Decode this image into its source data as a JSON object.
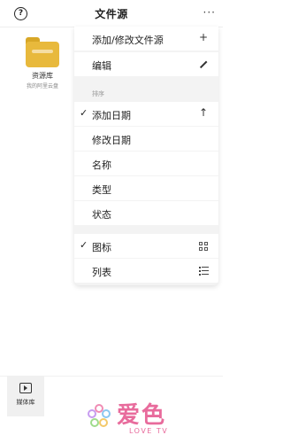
{
  "header": {
    "title": "文件源",
    "help_icon": "?",
    "more_icon": "···"
  },
  "source": {
    "name": "资源库",
    "subtitle": "我的阿里云盘",
    "icon": "folder-icon"
  },
  "menu": {
    "add_edit_source": {
      "label": "添加/修改文件源",
      "icon": "+"
    },
    "edit": {
      "label": "编辑"
    },
    "sort_header": "排序",
    "sort_options": [
      {
        "label": "添加日期",
        "checked": "✓",
        "icon": "↑"
      },
      {
        "label": "修改日期"
      },
      {
        "label": "名称"
      },
      {
        "label": "类型"
      },
      {
        "label": "状态"
      }
    ],
    "view_options": [
      {
        "label": "图标",
        "checked": "✓"
      },
      {
        "label": "列表"
      }
    ]
  },
  "bottom_tab": {
    "label": "媒体库"
  },
  "watermark": {
    "text": "爱色",
    "sub": "LOVE TV"
  }
}
